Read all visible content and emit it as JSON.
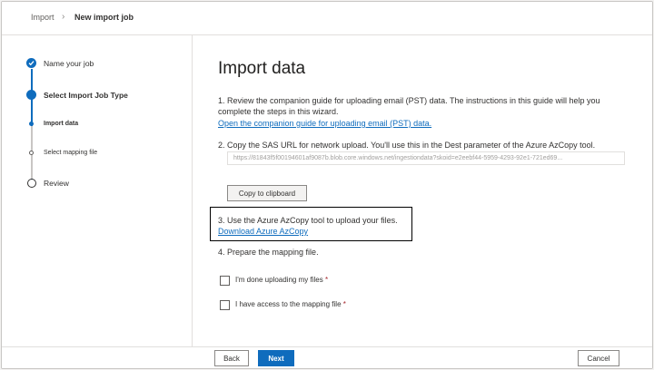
{
  "breadcrumb": {
    "parent": "Import",
    "separator": "›",
    "current": "New import job"
  },
  "steps": [
    {
      "label": "Name your job",
      "state": "completed"
    },
    {
      "label": "Select Import Job Type",
      "state": "current"
    },
    {
      "label": "Import data",
      "state": "current-substep"
    },
    {
      "label": "Select mapping file",
      "state": "upcoming-substep"
    },
    {
      "label": "Review",
      "state": "upcoming"
    }
  ],
  "main": {
    "title": "Import data",
    "step1_text": "1. Review the companion guide for uploading email (PST) data. The instructions in this guide will help you complete the steps in this wizard.",
    "step1_link": "Open the companion guide for uploading email (PST) data.",
    "step2_text": "2. Copy the SAS URL for network upload. You'll use this in the Dest parameter of the Azure AzCopy tool.",
    "sas_url": "https://81843f5f00194601af9087b.blob.core.windows.net/ingestiondata?skoid=e2eebf44-5959-4293-92e1-721ed69...",
    "copy_button": "Copy to clipboard",
    "step3_text": "3. Use the Azure AzCopy tool to upload your files.",
    "step3_link": "Download Azure AzCopy",
    "step4_text": "4. Prepare the mapping file.",
    "checkbox1_label": "I'm done uploading my files",
    "checkbox2_label": "I have access to the mapping file",
    "required_marker": "*"
  },
  "footer": {
    "back": "Back",
    "next": "Next",
    "cancel": "Cancel"
  },
  "colors": {
    "accent": "#0f6cbd",
    "required": "#a4262c",
    "highlight_border": "#000000"
  },
  "icons": {
    "completed_step": "checkmark-icon",
    "breadcrumb_separator": "chevron-right-icon"
  }
}
